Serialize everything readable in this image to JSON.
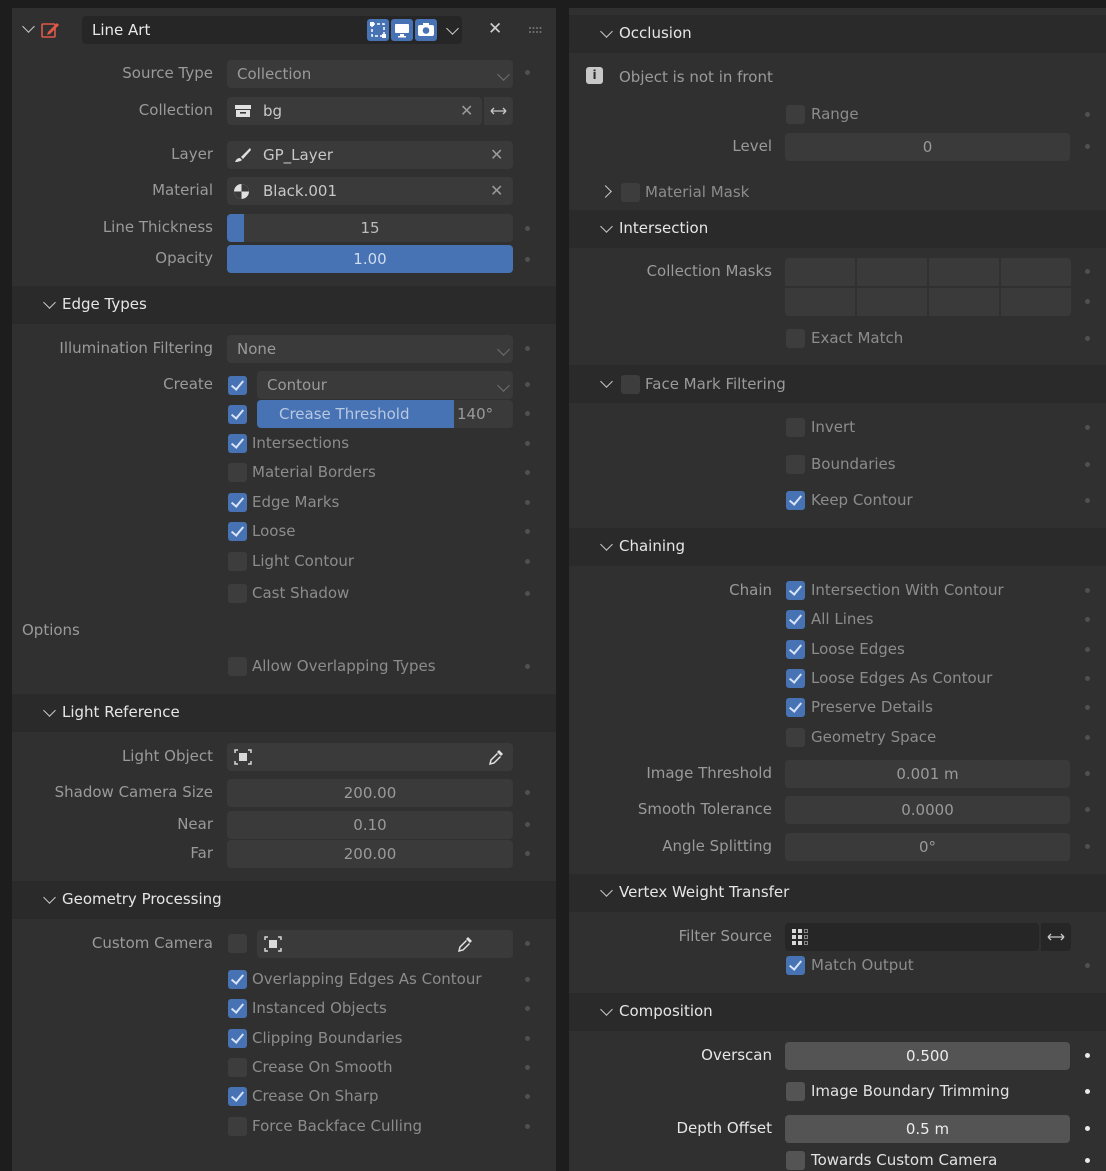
{
  "header": {
    "title": "Line Art",
    "close_symbol": "✕",
    "dropdown_symbol": "⌄"
  },
  "main": {
    "source_type_label": "Source Type",
    "source_type_value": "Collection",
    "collection_label": "Collection",
    "collection_value": "bg",
    "layer_label": "Layer",
    "layer_value": "GP_Layer",
    "material_label": "Material",
    "material_value": "Black.001",
    "thickness_label": "Line Thickness",
    "thickness_value": "15",
    "thickness_fraction": 0.06,
    "opacity_label": "Opacity",
    "opacity_value": "1.00",
    "opacity_fraction": 1.0
  },
  "edge_types": {
    "title": "Edge Types",
    "illumination_label": "Illumination Filtering",
    "illumination_value": "None",
    "create_label": "Create",
    "contour_value": "Contour",
    "crease_label": "Crease Threshold",
    "crease_value": "140°",
    "intersections": "Intersections",
    "material_borders": "Material Borders",
    "edge_marks": "Edge Marks",
    "loose": "Loose",
    "light_contour": "Light Contour",
    "cast_shadow": "Cast Shadow",
    "options_label": "Options",
    "allow_overlapping": "Allow Overlapping Types"
  },
  "light_reference": {
    "title": "Light Reference",
    "light_object_label": "Light Object",
    "shadow_size_label": "Shadow Camera Size",
    "shadow_size_value": "200.00",
    "near_label": "Near",
    "near_value": "0.10",
    "far_label": "Far",
    "far_value": "200.00"
  },
  "geometry": {
    "title": "Geometry Processing",
    "custom_camera_label": "Custom Camera",
    "overlapping_edges": "Overlapping Edges As Contour",
    "instanced_objects": "Instanced Objects",
    "clipping_boundaries": "Clipping Boundaries",
    "crease_smooth": "Crease On Smooth",
    "crease_sharp": "Crease On Sharp",
    "force_backface": "Force Backface Culling"
  },
  "occlusion": {
    "title": "Occlusion",
    "info_text": "Object is not in front",
    "range_label": "Range",
    "level_label": "Level",
    "level_value": "0",
    "material_mask": "Material Mask"
  },
  "intersection": {
    "title": "Intersection",
    "masks_label": "Collection Masks",
    "exact_match": "Exact Match"
  },
  "face_mark": {
    "title": "Face Mark Filtering",
    "invert": "Invert",
    "boundaries": "Boundaries",
    "keep_contour": "Keep Contour"
  },
  "chaining": {
    "title": "Chaining",
    "chain_label": "Chain",
    "intersection_contour": "Intersection With Contour",
    "all_lines": "All Lines",
    "loose_edges": "Loose Edges",
    "loose_as_contour": "Loose Edges As Contour",
    "preserve_details": "Preserve Details",
    "geometry_space": "Geometry Space",
    "image_threshold_label": "Image Threshold",
    "image_threshold_value": "0.001 m",
    "smooth_tolerance_label": "Smooth Tolerance",
    "smooth_tolerance_value": "0.0000",
    "angle_splitting_label": "Angle Splitting",
    "angle_splitting_value": "0°"
  },
  "vertex_weight": {
    "title": "Vertex Weight Transfer",
    "filter_source_label": "Filter Source",
    "match_output": "Match Output"
  },
  "composition": {
    "title": "Composition",
    "overscan_label": "Overscan",
    "overscan_value": "0.500",
    "boundary_trimming": "Image Boundary Trimming",
    "depth_offset_label": "Depth Offset",
    "depth_offset_value": "0.5 m",
    "towards_camera": "Towards Custom Camera"
  },
  "colors": {
    "accent": "#4772b3",
    "panel": "#303030",
    "header": "#2a2a2a",
    "field": "#3a3a3a"
  },
  "icons": [
    "chevron-down-icon",
    "grease-pencil-modifier-icon",
    "edit-mode-icon",
    "viewport-display-icon",
    "render-camera-icon",
    "close-icon",
    "drag-handle-icon",
    "collection-icon",
    "swap-icon",
    "brush-icon",
    "material-sphere-icon",
    "eyedropper-icon",
    "object-target-icon",
    "info-icon",
    "vertex-group-icon"
  ]
}
